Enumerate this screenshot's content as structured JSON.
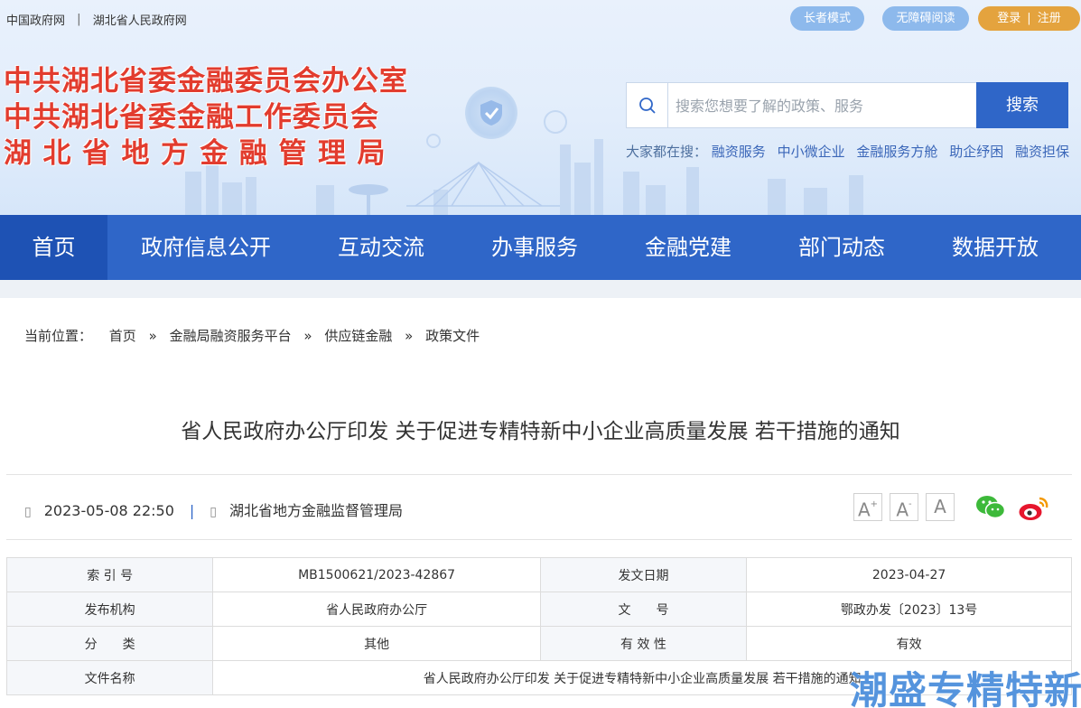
{
  "topbar": {
    "links": [
      "中国政府网",
      "湖北省人民政府网"
    ],
    "separator": "|",
    "elder_mode": "长者模式",
    "accessible_reading": "无障碍阅读",
    "login": "登录",
    "login_separator": "|",
    "register": "注册"
  },
  "site_title": {
    "line1": "中共湖北省委金融委员会办公室",
    "line2": "中共湖北省委金融工作委员会",
    "line3": "湖北省地方金融管理局"
  },
  "search": {
    "placeholder": "搜索您想要了解的政策、服务",
    "button": "搜索",
    "hot_label": "大家都在搜：",
    "hot_words": [
      "融资服务",
      "中小微企业",
      "金融服务方舱",
      "助企纾困",
      "融资担保"
    ]
  },
  "nav": {
    "items": [
      "首页",
      "政府信息公开",
      "互动交流",
      "办事服务",
      "金融党建",
      "部门动态",
      "数据开放"
    ],
    "active_index": 0
  },
  "breadcrumb": {
    "label": "当前位置：",
    "items": [
      "首页",
      "金融局融资服务平台",
      "供应链金融",
      "政策文件"
    ],
    "arrow": "»"
  },
  "article": {
    "title": "省人民政府办公厅印发 关于促进专精特新中小企业高质量发展 若干措施的通知",
    "datetime": "2023-05-08 22:50",
    "meta_separator": "|",
    "source": "湖北省地方金融监督管理局",
    "font_controls": {
      "increase": "A",
      "increase_mark": "+",
      "decrease": "A",
      "decrease_mark": "-",
      "reset": "A"
    }
  },
  "info_table": {
    "rows": [
      {
        "k1": "索 引 号",
        "v1": "MB1500621/2023-42867",
        "k2": "发文日期",
        "v2": "2023-04-27"
      },
      {
        "k1": "发布机构",
        "v1": "省人民政府办公厅",
        "k2": "文　　号",
        "v2": "鄂政办发〔2023〕13号"
      },
      {
        "k1": "分　　类",
        "v1": "其他",
        "k2": "有 效 性",
        "v2": "有效"
      }
    ],
    "file_name_label": "文件名称",
    "file_name": "省人民政府办公厅印发 关于促进专精特新中小企业高质量发展 若干措施的通知"
  },
  "watermark": "潮盛专精特新",
  "colors": {
    "primary_blue": "#2f66c8",
    "active_nav": "#1e52b4",
    "title_red": "#e23c2e",
    "login_orange": "#e4a33e",
    "pill_blue": "#8db9ec"
  }
}
